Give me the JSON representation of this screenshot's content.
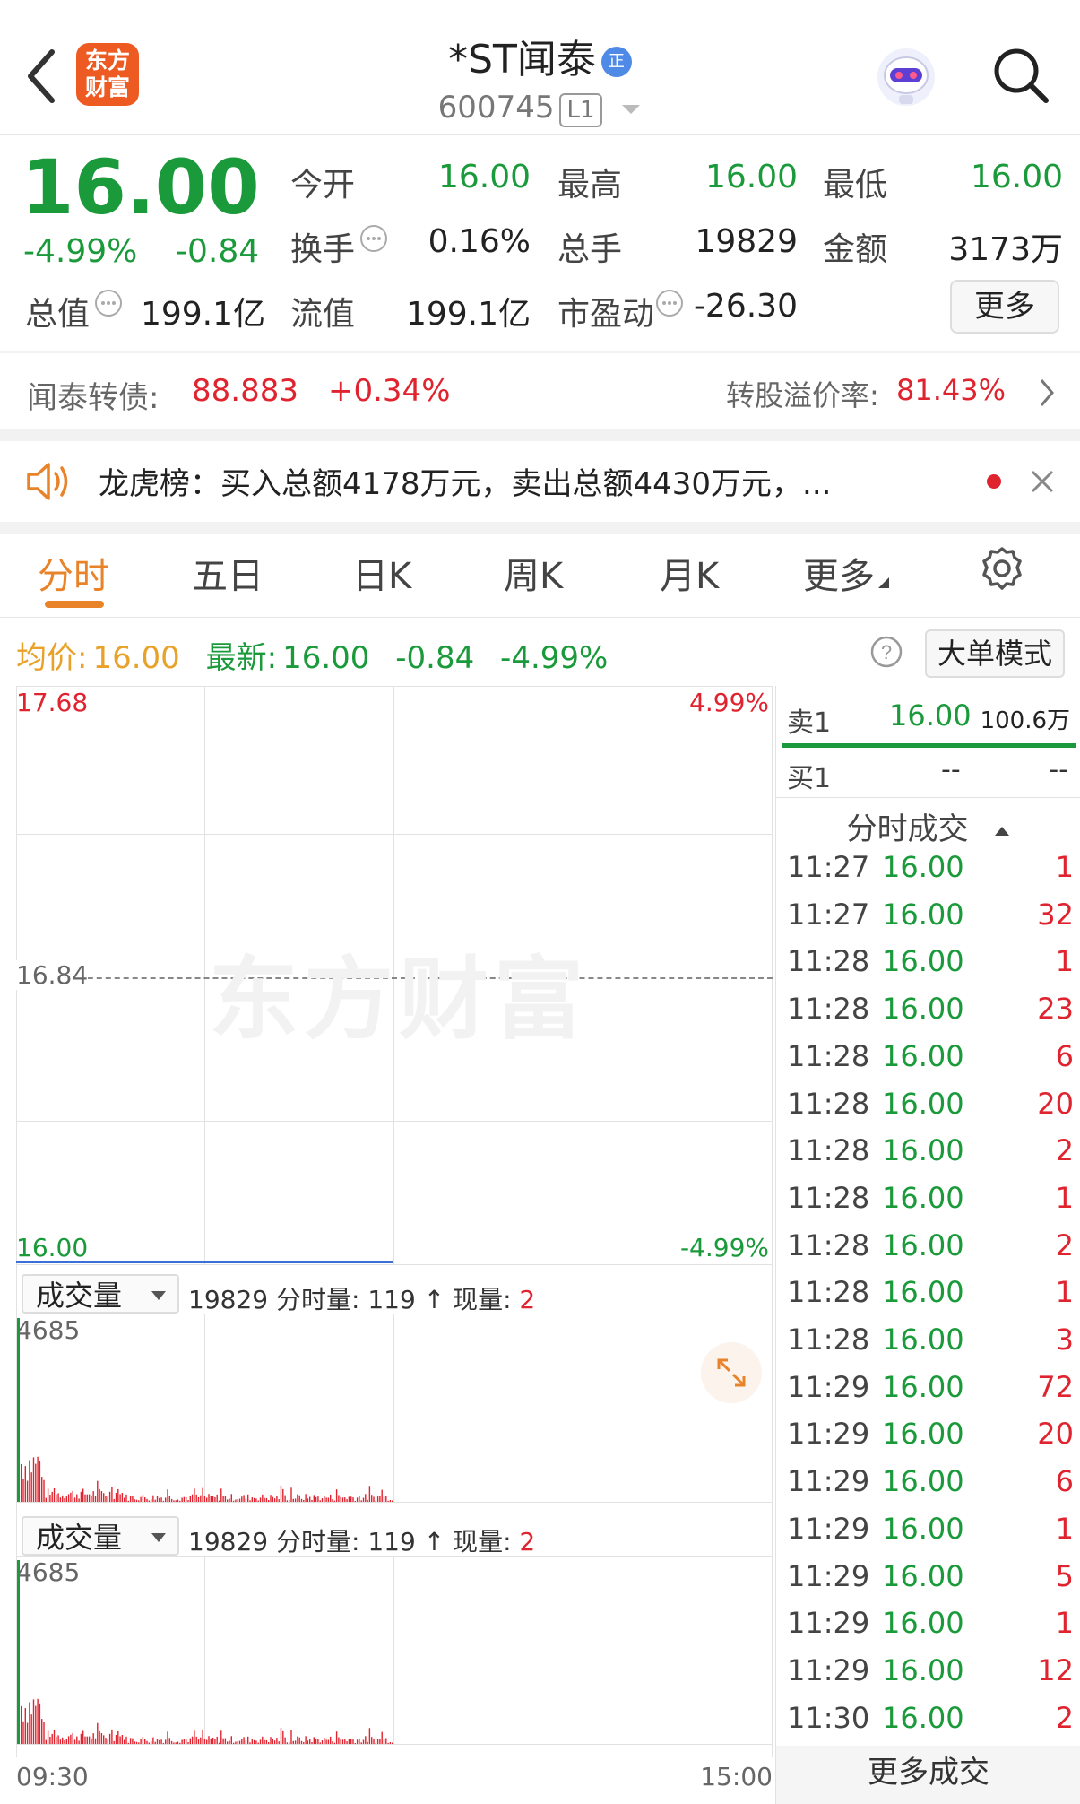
{
  "header": {
    "back_label": "<",
    "logo_text": "东方财富",
    "stock_name": "*ST闻泰",
    "badge_text": "正",
    "stock_code": "600745",
    "level_tag": "L1"
  },
  "quote": {
    "price": "16.00",
    "change_pct": "-4.99%",
    "change": "-0.84",
    "stats": [
      {
        "label": "今开",
        "value": "16.00"
      },
      {
        "label": "最高",
        "value": "16.00"
      },
      {
        "label": "最低",
        "value": "16.00"
      },
      {
        "label": "换手",
        "value": "0.16%"
      },
      {
        "label": "总手",
        "value": "19829"
      },
      {
        "label": "金额",
        "value": "3173万"
      },
      {
        "label": "总值",
        "value": "199.1亿"
      },
      {
        "label": "流值",
        "value": "199.1亿"
      },
      {
        "label": "市盈动",
        "value": "-26.30"
      }
    ],
    "more_label": "更多"
  },
  "bond": {
    "label": "闻泰转债:",
    "price": "88.883",
    "change": "+0.34%",
    "premium_label": "转股溢价率:",
    "premium_value": "81.43%"
  },
  "notice": {
    "text": "龙虎榜：买入总额4178万元，卖出总额4430万元，..."
  },
  "tabs": [
    {
      "label": "分时"
    },
    {
      "label": "五日"
    },
    {
      "label": "日K"
    },
    {
      "label": "周K"
    },
    {
      "label": "月K"
    },
    {
      "label": "更多"
    }
  ],
  "info_bar": {
    "avg_label": "均价:",
    "avg_value": "16.00",
    "latest_label": "最新:",
    "latest_value": "16.00",
    "latest_change": "-0.84",
    "latest_pct": "-4.99%",
    "mode_button": "大单模式"
  },
  "price_chart": {
    "top_price": "17.68",
    "top_pct": "4.99%",
    "mid_price": "16.84",
    "bottom_price": "16.00",
    "bottom_pct": "-4.99%",
    "watermark": "东方财富"
  },
  "volume_panels": [
    {
      "selector": "成交量",
      "total": "19829",
      "minute_label": "分时量:",
      "minute_value": "119",
      "current_label": "现量:",
      "current_value": "2",
      "max": "4685"
    },
    {
      "selector": "成交量",
      "total": "19829",
      "minute_label": "分时量:",
      "minute_value": "119",
      "current_label": "现量:",
      "current_value": "2",
      "max": "4685"
    }
  ],
  "time_axis": {
    "start": "09:30",
    "end": "15:00"
  },
  "order_book": {
    "sell1_label": "卖1",
    "sell1_price": "16.00",
    "sell1_vol": "100.6万",
    "buy1_label": "买1",
    "buy1_price": "--",
    "buy1_vol": "--"
  },
  "trades": {
    "title": "分时成交",
    "rows": [
      {
        "time": "11:27",
        "price": "16.00",
        "vol": "1"
      },
      {
        "time": "11:27",
        "price": "16.00",
        "vol": "32"
      },
      {
        "time": "11:28",
        "price": "16.00",
        "vol": "1"
      },
      {
        "time": "11:28",
        "price": "16.00",
        "vol": "23"
      },
      {
        "time": "11:28",
        "price": "16.00",
        "vol": "6"
      },
      {
        "time": "11:28",
        "price": "16.00",
        "vol": "20"
      },
      {
        "time": "11:28",
        "price": "16.00",
        "vol": "2"
      },
      {
        "time": "11:28",
        "price": "16.00",
        "vol": "1"
      },
      {
        "time": "11:28",
        "price": "16.00",
        "vol": "2"
      },
      {
        "time": "11:28",
        "price": "16.00",
        "vol": "1"
      },
      {
        "time": "11:28",
        "price": "16.00",
        "vol": "3"
      },
      {
        "time": "11:29",
        "price": "16.00",
        "vol": "72"
      },
      {
        "time": "11:29",
        "price": "16.00",
        "vol": "20"
      },
      {
        "time": "11:29",
        "price": "16.00",
        "vol": "6"
      },
      {
        "time": "11:29",
        "price": "16.00",
        "vol": "1"
      },
      {
        "time": "11:29",
        "price": "16.00",
        "vol": "5"
      },
      {
        "time": "11:29",
        "price": "16.00",
        "vol": "1"
      },
      {
        "time": "11:29",
        "price": "16.00",
        "vol": "12"
      },
      {
        "time": "11:30",
        "price": "16.00",
        "vol": "2"
      }
    ],
    "more_label": "更多成交"
  },
  "colors": {
    "up": "#e0242f",
    "down": "#1a9a3a",
    "accent": "#e8832a",
    "line": "#3b6fd8"
  }
}
